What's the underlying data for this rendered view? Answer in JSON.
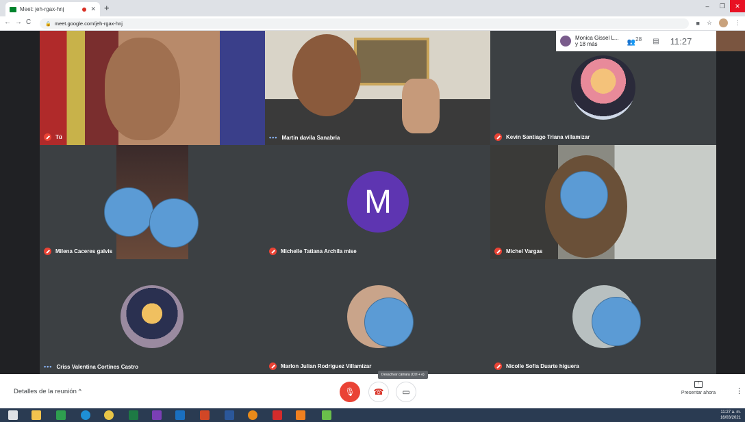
{
  "browser": {
    "tab_title": "Meet: jeh-rgax-hnj",
    "new_tab": "+",
    "url": "meet.google.com/jeh-rgax-hnj"
  },
  "topbar": {
    "presenter_name": "Monica Gissel L...",
    "presenter_more": "y 18 más",
    "people_count": "28",
    "clock": "11:27"
  },
  "participants": [
    {
      "name": "Tú",
      "status": "muted"
    },
    {
      "name": "Martin davila Sanabria",
      "status": "speaking"
    },
    {
      "name": "Kevin Santiago Triana villamizar",
      "status": "muted"
    },
    {
      "name": "Milena Caceres galvis",
      "status": "muted"
    },
    {
      "name": "Michelle Tatiana Archila mise",
      "status": "muted",
      "initial": "M"
    },
    {
      "name": "Michel Vargas",
      "status": "muted"
    },
    {
      "name": "Criss Valentina Cortines Castro",
      "status": "speaking"
    },
    {
      "name": "Marlon Julian Rodriguez Villamizar",
      "status": "muted"
    },
    {
      "name": "Nicolle Sofia Duarte higuera",
      "status": "muted"
    }
  ],
  "controls": {
    "details_label": "Detalles de la reunión",
    "tooltip": "Desactivar cámara (Ctrl + e)",
    "present_label": "Presentar ahora"
  },
  "taskbar": {
    "time": "11:27 a. m.",
    "date": "16/03/2021"
  },
  "colors": {
    "meet_bg": "#202124",
    "muted_red": "#ea4335",
    "avatar_purple": "#5e35b1",
    "blur_blue": "#5b9bd5"
  }
}
